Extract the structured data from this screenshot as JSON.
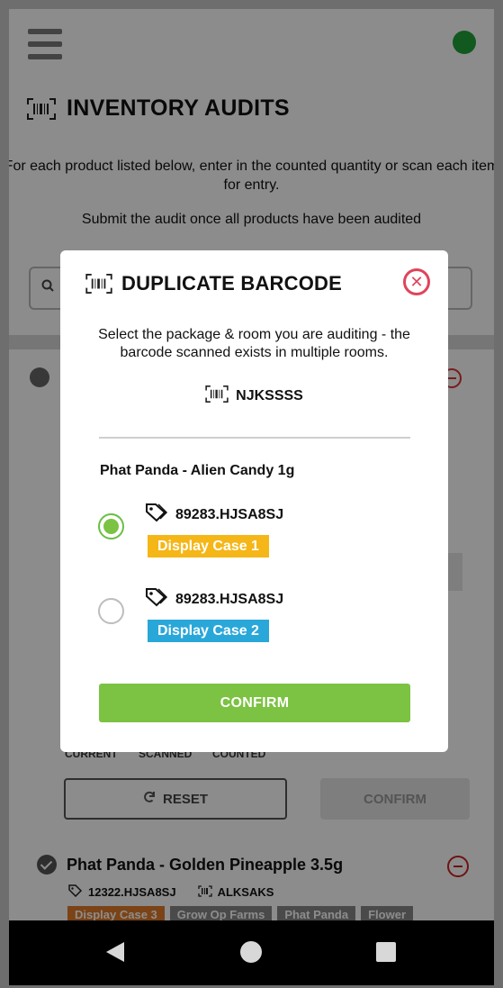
{
  "header": {
    "title": "INVENTORY AUDITS",
    "instructions_line": "For each product listed below, enter in the counted quantity or scan each item for entry.",
    "submit_note": "Submit the audit once all products have been audited"
  },
  "audit_item": {
    "qty_labels": [
      "CURRENT",
      "SCANNED",
      "COUNTED"
    ],
    "reset_label": "RESET",
    "confirm_label": "CONFIRM"
  },
  "next_product": {
    "name": "Phat Panda - Golden Pineapple 3.5g",
    "package": "12322.HJSA8SJ",
    "barcode": "ALKSAKS",
    "tags": [
      "Display Case 3",
      "Grow Op Farms",
      "Phat Panda",
      "Flower"
    ]
  },
  "modal": {
    "title": "DUPLICATE BARCODE",
    "close_symbol": "✕",
    "description": "Select the package & room you are auditing - the barcode scanned exists in multiple rooms.",
    "barcode": "NJKSSSS",
    "product": "Phat Panda - Alien Candy 1g",
    "options": [
      {
        "package": "89283.HJSA8SJ",
        "room": "Display Case 1",
        "room_color": "#f5b617",
        "selected": true
      },
      {
        "package": "89283.HJSA8SJ",
        "room": "Display Case 2",
        "room_color": "#2aa7d9",
        "selected": false
      }
    ],
    "confirm_label": "CONFIRM"
  },
  "colors": {
    "accent_green": "#7cc243",
    "close_red": "#e0445a",
    "status_green": "#1fa33a"
  },
  "icons": [
    "menu-icon",
    "barcode-icon",
    "search-icon",
    "tag-icon",
    "close-icon",
    "refresh-icon",
    "back-icon",
    "home-icon",
    "recent-apps-icon"
  ]
}
